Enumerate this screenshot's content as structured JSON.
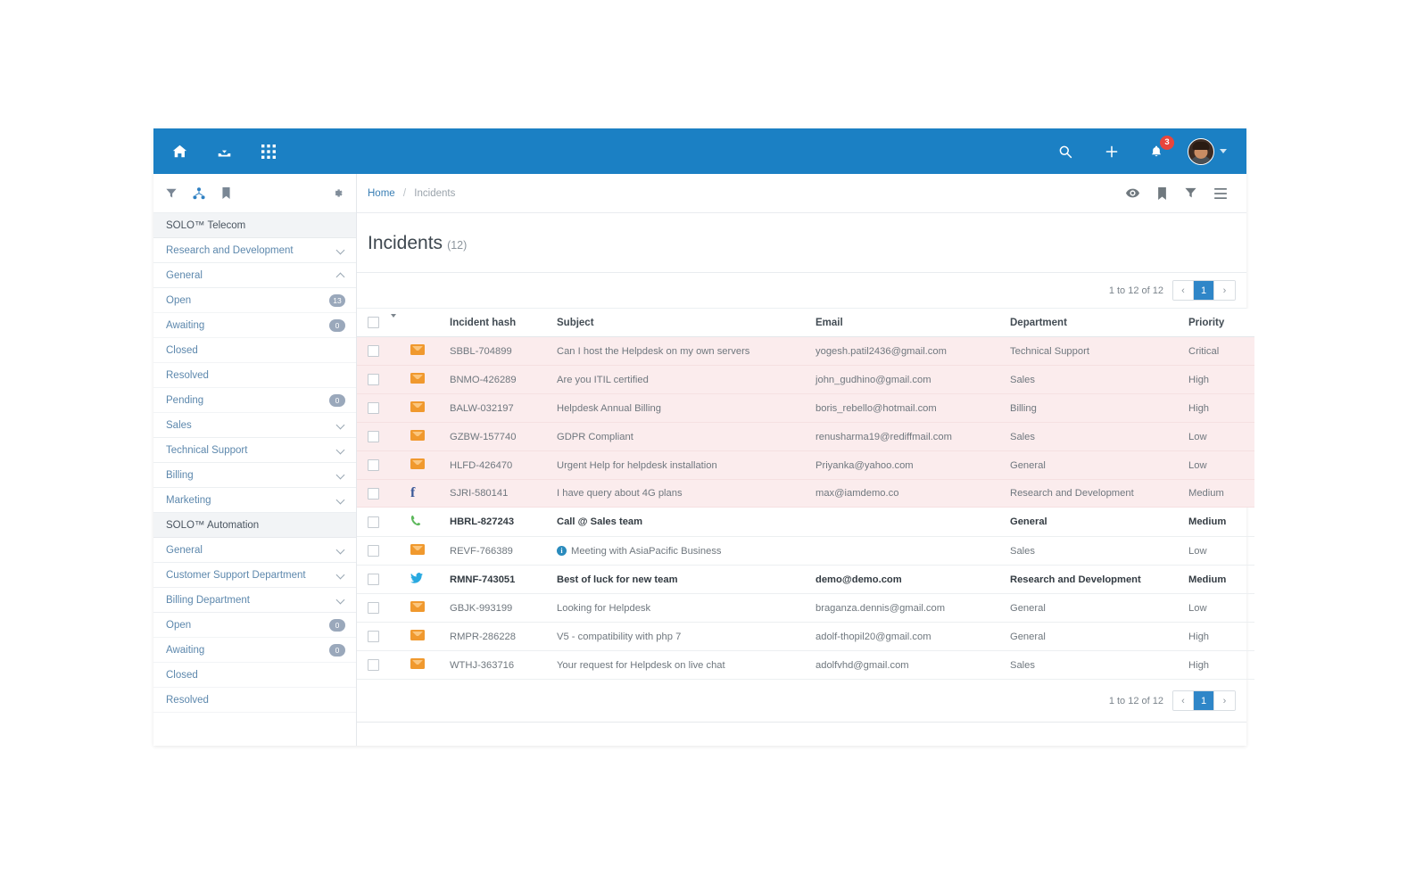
{
  "topbar": {
    "left_icons": [
      {
        "name": "home-icon",
        "label": "Home"
      },
      {
        "name": "inbox-download-icon",
        "label": "Inbox"
      },
      {
        "name": "apps-grid-icon",
        "label": "Apps"
      }
    ],
    "right_icons": [
      {
        "name": "search-icon",
        "label": "Search"
      },
      {
        "name": "add-icon",
        "label": "Add"
      },
      {
        "name": "notifications-bell-icon",
        "label": "Notifications"
      }
    ],
    "notification_count": "3",
    "accent_color": "#1b80c4"
  },
  "sidebar": {
    "tools": [
      {
        "name": "filter-icon",
        "label": "Filter",
        "active": false
      },
      {
        "name": "sitemap-icon",
        "label": "Sitemap",
        "active": true
      },
      {
        "name": "bookmark-icon",
        "label": "Bookmark",
        "active": false
      },
      {
        "name": "gear-icon",
        "label": "Settings",
        "active": false
      }
    ],
    "groups": [
      {
        "title": "SOLO™ Telecom",
        "departments": [
          {
            "label": "Research and Development",
            "expanded": false,
            "statuses": []
          },
          {
            "label": "General",
            "expanded": true,
            "statuses": [
              {
                "label": "Open",
                "count": "13"
              },
              {
                "label": "Awaiting",
                "count": "0"
              },
              {
                "label": "Closed",
                "count": ""
              },
              {
                "label": "Resolved",
                "count": ""
              },
              {
                "label": "Pending",
                "count": "0"
              }
            ]
          },
          {
            "label": "Sales",
            "expanded": false,
            "statuses": []
          },
          {
            "label": "Technical Support",
            "expanded": false,
            "statuses": []
          },
          {
            "label": "Billing",
            "expanded": false,
            "statuses": []
          },
          {
            "label": "Marketing",
            "expanded": false,
            "statuses": []
          }
        ]
      },
      {
        "title": "SOLO™ Automation",
        "departments": [
          {
            "label": "General",
            "expanded": false,
            "statuses": []
          },
          {
            "label": "Customer Support Department",
            "expanded": false,
            "statuses": []
          },
          {
            "label": "Billing Department",
            "expanded": false,
            "statuses": [
              {
                "label": "Open",
                "count": "0"
              },
              {
                "label": "Awaiting",
                "count": "0"
              },
              {
                "label": "Closed",
                "count": ""
              },
              {
                "label": "Resolved",
                "count": ""
              }
            ]
          }
        ]
      }
    ]
  },
  "breadcrumb": {
    "home": "Home",
    "separator": "/",
    "current": "Incidents",
    "tools": [
      {
        "name": "eye-icon",
        "label": "Preview"
      },
      {
        "name": "bookmark-icon",
        "label": "Bookmark"
      },
      {
        "name": "filter-icon",
        "label": "Filter"
      },
      {
        "name": "hamburger-menu-icon",
        "label": "Menu"
      }
    ]
  },
  "page": {
    "title": "Incidents",
    "count": "(12)"
  },
  "pagination": {
    "info": "1 to 12 of 12",
    "prev": "‹",
    "current_page": "1",
    "next": "›"
  },
  "table": {
    "columns": [
      "Incident hash",
      "Subject",
      "Email",
      "Department",
      "Priority"
    ],
    "rows": [
      {
        "icon": "mail-icon",
        "hash": "SBBL-704899",
        "subject": "Can I host the Helpdesk on my own servers",
        "email": "yogesh.patil2436@gmail.com",
        "department": "Technical Support",
        "priority": "Critical",
        "alert": true,
        "bold": false,
        "info": false
      },
      {
        "icon": "mail-icon",
        "hash": "BNMO-426289",
        "subject": "Are you ITIL certified",
        "email": "john_gudhino@gmail.com",
        "department": "Sales",
        "priority": "High",
        "alert": true,
        "bold": false,
        "info": false
      },
      {
        "icon": "mail-icon",
        "hash": "BALW-032197",
        "subject": "Helpdesk Annual Billing",
        "email": "boris_rebello@hotmail.com",
        "department": "Billing",
        "priority": "High",
        "alert": true,
        "bold": false,
        "info": false
      },
      {
        "icon": "mail-icon",
        "hash": "GZBW-157740",
        "subject": "GDPR Compliant",
        "email": "renusharma19@rediffmail.com",
        "department": "Sales",
        "priority": "Low",
        "alert": true,
        "bold": false,
        "info": false
      },
      {
        "icon": "mail-icon",
        "hash": "HLFD-426470",
        "subject": "Urgent Help for helpdesk installation",
        "email": "Priyanka@yahoo.com",
        "department": "General",
        "priority": "Low",
        "alert": true,
        "bold": false,
        "info": false
      },
      {
        "icon": "facebook-icon",
        "hash": "SJRI-580141",
        "subject": "I have query about 4G plans",
        "email": "max@iamdemo.co",
        "department": "Research and Development",
        "priority": "Medium",
        "alert": true,
        "bold": false,
        "info": false
      },
      {
        "icon": "phone-icon",
        "hash": "HBRL-827243",
        "subject": "Call @ Sales team",
        "email": "",
        "department": "General",
        "priority": "Medium",
        "alert": false,
        "bold": true,
        "info": false
      },
      {
        "icon": "mail-icon",
        "hash": "REVF-766389",
        "subject": "Meeting with AsiaPacific Business",
        "email": "",
        "department": "Sales",
        "priority": "Low",
        "alert": false,
        "bold": false,
        "info": true
      },
      {
        "icon": "twitter-icon",
        "hash": "RMNF-743051",
        "subject": "Best of luck for new team",
        "email": "demo@demo.com",
        "department": "Research and Development",
        "priority": "Medium",
        "alert": false,
        "bold": true,
        "info": false
      },
      {
        "icon": "mail-icon",
        "hash": "GBJK-993199",
        "subject": "Looking for Helpdesk",
        "email": "braganza.dennis@gmail.com",
        "department": "General",
        "priority": "Low",
        "alert": false,
        "bold": false,
        "info": false
      },
      {
        "icon": "mail-icon",
        "hash": "RMPR-286228",
        "subject": "V5 - compatibility with php 7",
        "email": "adolf-thopil20@gmail.com",
        "department": "General",
        "priority": "High",
        "alert": false,
        "bold": false,
        "info": false
      },
      {
        "icon": "mail-icon",
        "hash": "WTHJ-363716",
        "subject": "Your request for Helpdesk on live chat",
        "email": "adolfvhd@gmail.com",
        "department": "Sales",
        "priority": "High",
        "alert": false,
        "bold": false,
        "info": false
      }
    ]
  },
  "colors": {
    "brand_blue": "#1b80c4",
    "alert_row": "#fbeced",
    "critical": "#e0443c",
    "high": "#f0ad4e",
    "medium": "#f5e03a",
    "low": "#6aa84f",
    "mail_icon": "#f0992e",
    "facebook": "#3b5998",
    "twitter": "#29a9e0",
    "phone": "#5db85c"
  }
}
